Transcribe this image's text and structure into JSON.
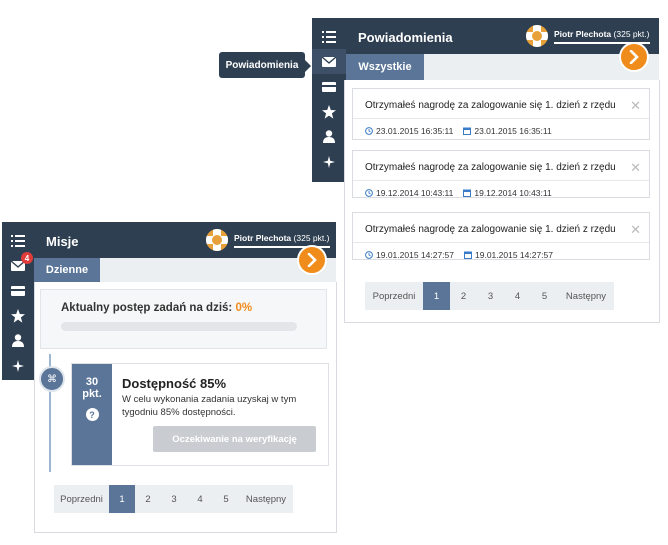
{
  "notifications_panel": {
    "title": "Powiadomienia",
    "tooltip": "Powiadomienia",
    "user": {
      "name": "Piotr Plechota",
      "points": "(325 pkt.)"
    },
    "tab": "Wszystkie",
    "items": [
      {
        "message": "Otrzymałeś nagrodę za zalogowanie się 1. dzień z rzędu",
        "time": "23.01.2015 16:35:11",
        "date": "23.01.2015 16:35:11"
      },
      {
        "message": "Otrzymałeś nagrodę za zalogowanie się 1. dzień z rzędu",
        "time": "19.12.2014 10:43:11",
        "date": "19.12.2014 10:43:11"
      },
      {
        "message": "Otrzymałeś nagrodę za zalogowanie się 1. dzień z rzędu",
        "time": "19.01.2015 14:27:57",
        "date": "19.01.2015 14:27:57"
      }
    ],
    "pager": {
      "prev": "Poprzedni",
      "pages": [
        "1",
        "2",
        "3",
        "4",
        "5"
      ],
      "next": "Następny",
      "active": "1"
    }
  },
  "missions_panel": {
    "title": "Misje",
    "user": {
      "name": "Piotr Plechota",
      "points": "(325 pkt.)"
    },
    "tab": "Dzienne",
    "progress": {
      "label": "Aktualny postęp zadań na dziś:",
      "value": "0%",
      "fraction": 0.0
    },
    "mission": {
      "points_value": "30",
      "points_unit": "pkt.",
      "help": "?",
      "title": "Dostępność 85%",
      "description": "W celu wykonania zadania uzyskaj w tym tygodniu 85% dostępności.",
      "button": "Oczekiwanie na weryfikację"
    },
    "pager": {
      "prev": "Poprzedni",
      "pages": [
        "1",
        "2",
        "3",
        "4",
        "5"
      ],
      "next": "Następny",
      "active": "1"
    }
  },
  "rail": {
    "badge_count": "4"
  },
  "icons": [
    "list-icon",
    "envelope-icon",
    "card-icon",
    "star-icon",
    "person-icon",
    "sparkle-icon",
    "chevron-right-icon",
    "clock-icon",
    "calendar-icon",
    "close-icon",
    "command-icon"
  ],
  "colors": {
    "dark": "#2f3f52",
    "accent": "#f08c1c",
    "tab": "#5a7597",
    "badge": "#e03c3c"
  }
}
